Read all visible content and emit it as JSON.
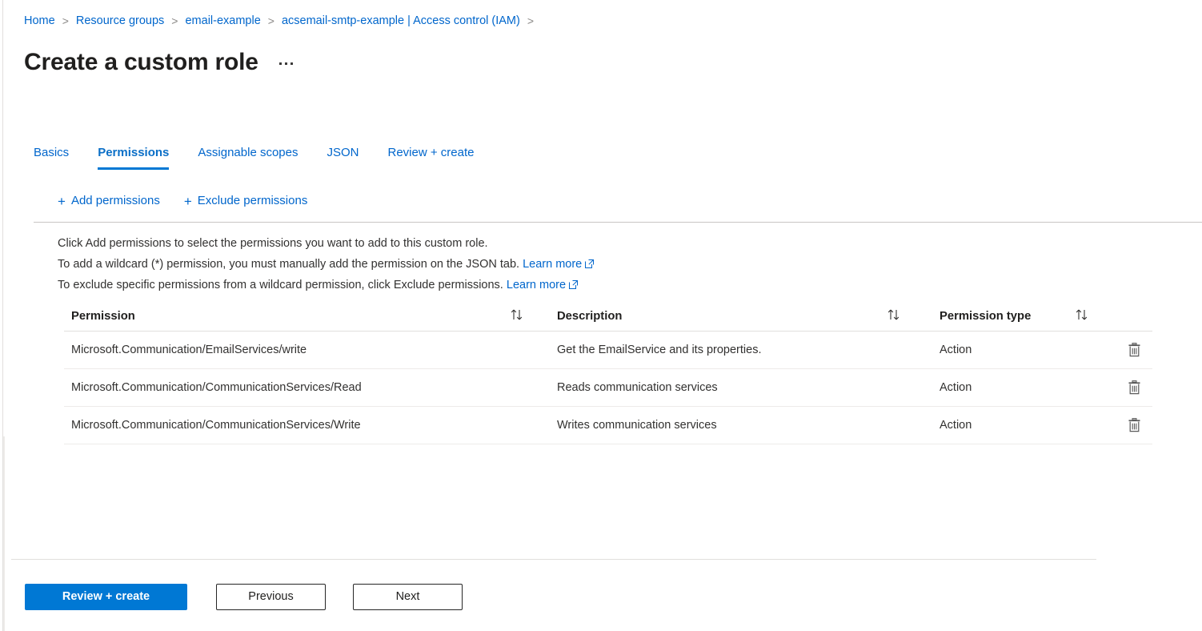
{
  "colors": {
    "accent": "#0078d4",
    "link": "#0066cc",
    "text": "#323130",
    "border": "#e1dfdd"
  },
  "breadcrumb": {
    "items": [
      {
        "label": "Home"
      },
      {
        "label": "Resource groups"
      },
      {
        "label": "email-example"
      },
      {
        "label": "acsemail-smtp-example | Access control (IAM)"
      }
    ],
    "separator": ">"
  },
  "header": {
    "title": "Create a custom role",
    "more_menu": "more-commands"
  },
  "tabs": [
    {
      "label": "Basics",
      "active": false
    },
    {
      "label": "Permissions",
      "active": true
    },
    {
      "label": "Assignable scopes",
      "active": false
    },
    {
      "label": "JSON",
      "active": false
    },
    {
      "label": "Review + create",
      "active": false
    }
  ],
  "commandbar": {
    "plus": "+",
    "items": [
      {
        "label": "Add permissions"
      },
      {
        "label": "Exclude permissions"
      }
    ]
  },
  "instructions": {
    "line1": "Click Add permissions to select the permissions you want to add to this custom role.",
    "line2_prefix": "To add a wildcard (*) permission, you must manually add the permission on the JSON tab.",
    "line2_link": "Learn more",
    "line3_prefix": "To exclude specific permissions from a wildcard permission, click Exclude permissions.",
    "line3_link": "Learn more"
  },
  "table": {
    "columns": {
      "permission": "Permission",
      "description": "Description",
      "permission_type": "Permission type"
    },
    "sort_icon": "sort-icon",
    "delete_icon": "trash-icon",
    "rows": [
      {
        "permission": "Microsoft.Communication/EmailServices/write",
        "description": "Get the EmailService and its properties.",
        "type": "Action"
      },
      {
        "permission": "Microsoft.Communication/CommunicationServices/Read",
        "description": "Reads communication services",
        "type": "Action"
      },
      {
        "permission": "Microsoft.Communication/CommunicationServices/Write",
        "description": "Writes communication services",
        "type": "Action"
      }
    ]
  },
  "footer": {
    "review_create": "Review + create",
    "previous": "Previous",
    "next": "Next"
  }
}
